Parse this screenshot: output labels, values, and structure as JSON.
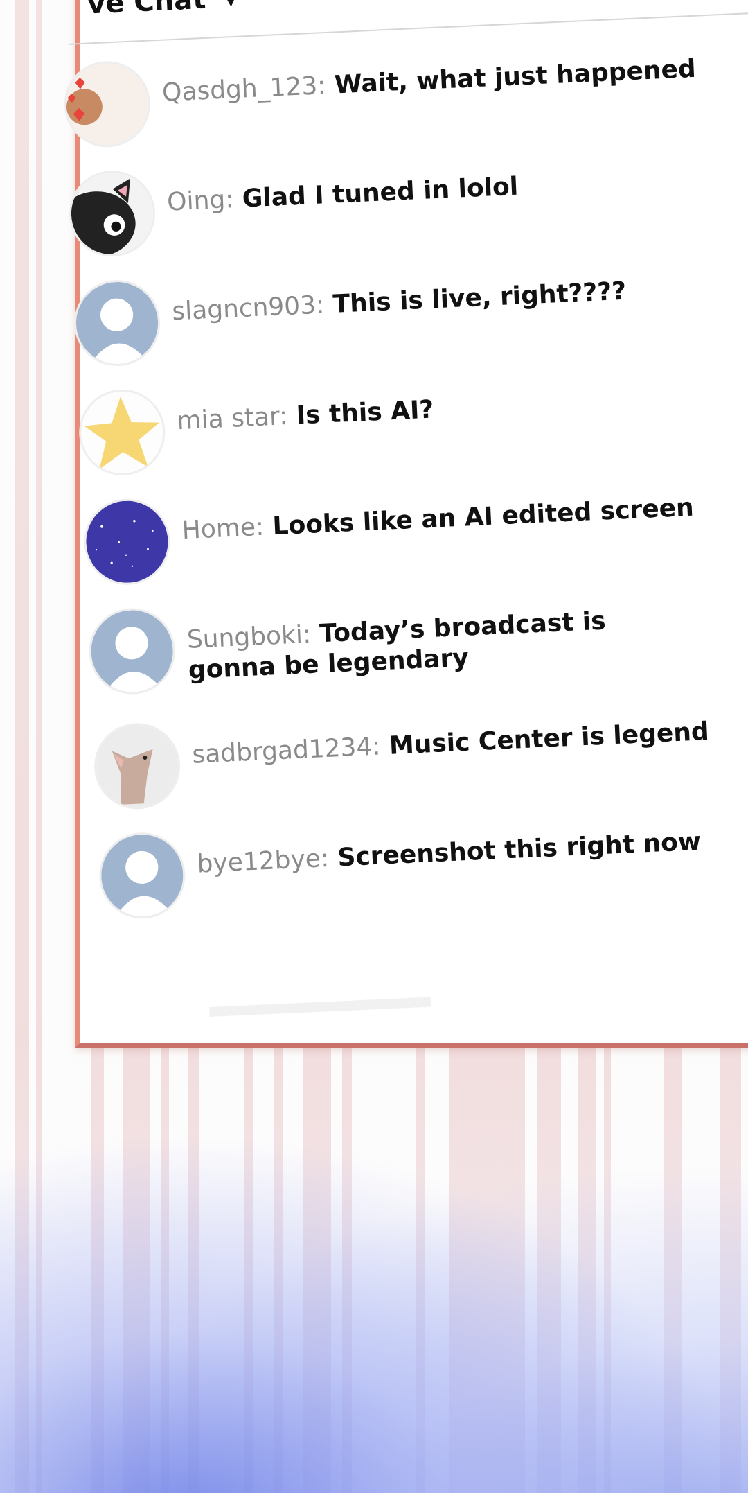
{
  "header": {
    "title": "ve Chat",
    "caret": "▾"
  },
  "messages": [
    {
      "user": "Qasdgh_123:",
      "text": "Wait, what just happened",
      "avatar": "hearts-avatar-icon"
    },
    {
      "user": "Oing:",
      "text": "Glad I tuned in lolol",
      "avatar": "black-cat-avatar-icon"
    },
    {
      "user": "slagncn903:",
      "text": "This is live, right????",
      "avatar": "default-user-avatar-icon"
    },
    {
      "user": "mia star:",
      "text": "Is this AI?",
      "avatar": "star-avatar-icon"
    },
    {
      "user": "Home:",
      "text": "Looks like an AI edited screen",
      "avatar": "galaxy-avatar-icon"
    },
    {
      "user": "Sungboki:",
      "text": "Today’s broadcast is gonna be legendary",
      "avatar": "default-user-avatar-icon"
    },
    {
      "user": "sadbrgad1234:",
      "text": "Music Center is legend",
      "avatar": "fox-avatar-icon"
    },
    {
      "user": "bye12bye:",
      "text": "Screenshot this right now",
      "avatar": "default-user-avatar-icon"
    }
  ],
  "colors": {
    "panel_border": "#e98978",
    "username": "#8a8a8a",
    "message": "#111111",
    "default_avatar": "#9fb4cf"
  }
}
